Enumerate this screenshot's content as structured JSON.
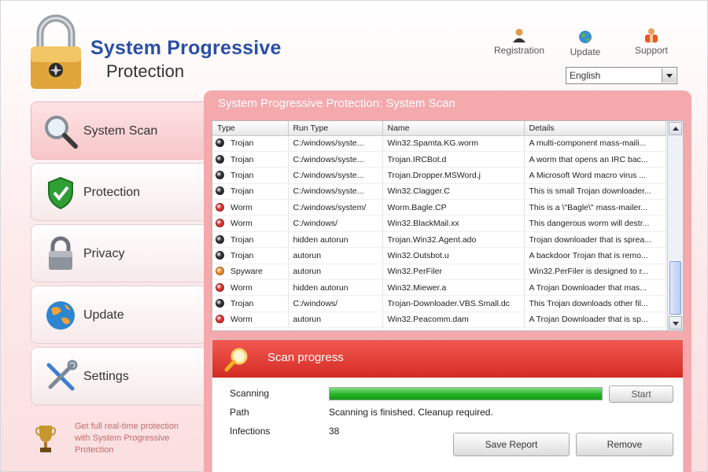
{
  "app": {
    "title": "System Progressive",
    "subtitle": "Protection"
  },
  "top_links": [
    {
      "label": "Registration",
      "icon": "user-icon"
    },
    {
      "label": "Update",
      "icon": "globe-icon"
    },
    {
      "label": "Support",
      "icon": "lifebuoy-user-icon"
    }
  ],
  "language": {
    "selected": "English"
  },
  "sidebar": {
    "items": [
      {
        "label": "System Scan",
        "icon": "magnifier-icon",
        "active": true
      },
      {
        "label": "Protection",
        "icon": "shield-check-icon",
        "active": false
      },
      {
        "label": "Privacy",
        "icon": "padlock-icon",
        "active": false
      },
      {
        "label": "Update",
        "icon": "globe-icon",
        "active": false
      },
      {
        "label": "Settings",
        "icon": "tools-icon",
        "active": false
      }
    ],
    "promo": "Get full real-time protection with System Progressive Protection"
  },
  "main": {
    "panel_title": "System Progressive Protection: System Scan",
    "table": {
      "columns": [
        "Type",
        "Run Type",
        "Name",
        "Details"
      ],
      "rows": [
        {
          "type": "Trojan",
          "run": "C:/windows/syste...",
          "name": "Win32.Spamta.KG.worm",
          "details": "A multi-component mass-maili..."
        },
        {
          "type": "Trojan",
          "run": "C:/windows/syste...",
          "name": "Trojan.IRCBot.d",
          "details": "A worm that opens an IRC bac..."
        },
        {
          "type": "Trojan",
          "run": "C:/windows/syste...",
          "name": "Trojan.Dropper.MSWord.j",
          "details": "A Microsoft Word macro virus ..."
        },
        {
          "type": "Trojan",
          "run": "C:/windows/syste...",
          "name": "Win32.Clagger.C",
          "details": "This is small Trojan downloader..."
        },
        {
          "type": "Worm",
          "run": "C:/windows/system/",
          "name": "Worm.Bagle.CP",
          "details": "This is a \\\"Bagle\\\" mass-mailer..."
        },
        {
          "type": "Worm",
          "run": "C:/windows/",
          "name": "Win32.BlackMail.xx",
          "details": "This dangerous worm will destr..."
        },
        {
          "type": "Trojan",
          "run": "hidden autorun",
          "name": "Trojan.Win32.Agent.ado",
          "details": "Trojan downloader that is sprea..."
        },
        {
          "type": "Trojan",
          "run": "autorun",
          "name": "Win32.Outsbot.u",
          "details": "A backdoor Trojan that is remo..."
        },
        {
          "type": "Spyware",
          "run": "autorun",
          "name": "Win32.PerFiler",
          "details": "Win32.PerFiler is designed to r..."
        },
        {
          "type": "Worm",
          "run": "hidden autorun",
          "name": "Win32.Miewer.a",
          "details": "A Trojan Downloader that mas..."
        },
        {
          "type": "Trojan",
          "run": "C:/windows/",
          "name": "Trojan-Downloader.VBS.Small.dc",
          "details": "This Trojan downloads other fil..."
        },
        {
          "type": "Worm",
          "run": "autorun",
          "name": "Win32.Peacomm.dam",
          "details": "A Trojan Downloader that is sp..."
        }
      ],
      "type_colors": {
        "Trojan": "#2b2b2b",
        "Worm": "#d9302c",
        "Spyware": "#f08a1c"
      }
    },
    "scan": {
      "title": "Scan progress",
      "scanning_label": "Scanning",
      "progress_fraction": 1.0,
      "start_label": "Start",
      "path_label": "Path",
      "path_value": "Scanning is finished. Cleanup required.",
      "infections_label": "Infections",
      "infections_value": "38",
      "save_report_label": "Save Report",
      "remove_label": "Remove"
    }
  },
  "colors": {
    "brand_blue": "#2a4fa3",
    "panel_pink": "#f4a9ad",
    "scan_header_red": "#d42b24",
    "progress_green": "#27b227"
  }
}
